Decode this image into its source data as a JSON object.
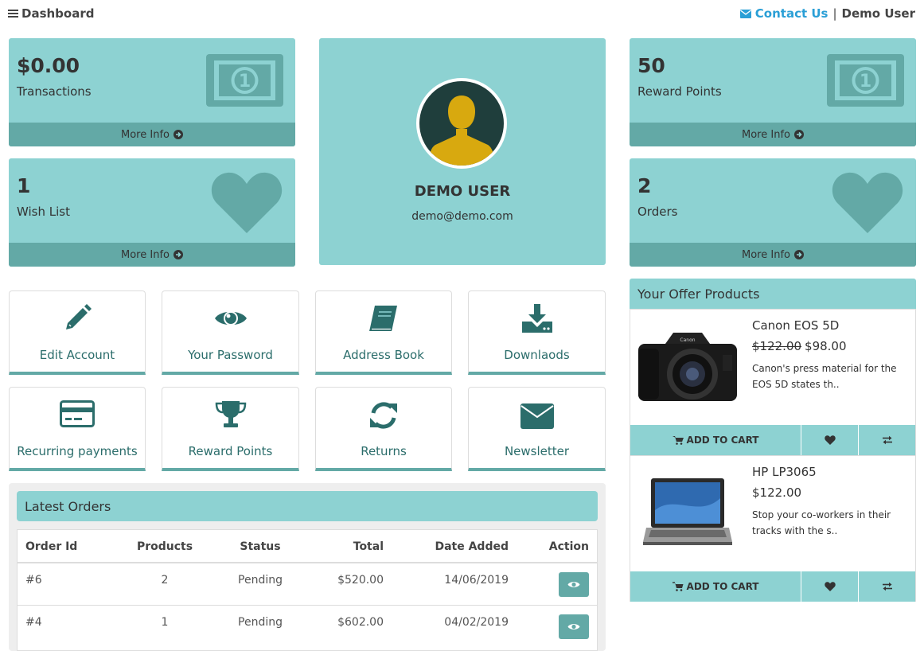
{
  "header": {
    "dashboard_label": "Dashboard",
    "menu_icon": "bars-icon",
    "contact_label": "Contact Us",
    "contact_icon": "envelope-icon",
    "separator": "|",
    "user_label": "Demo User"
  },
  "tiles": {
    "transactions": {
      "value": "$0.00",
      "label": "Transactions",
      "more": "More Info",
      "icon": "money-bill-icon"
    },
    "wishlist": {
      "value": "1",
      "label": "Wish List",
      "more": "More Info",
      "icon": "heart-icon"
    },
    "reward": {
      "value": "50",
      "label": "Reward Points",
      "more": "More Info",
      "icon": "money-bill-icon"
    },
    "orders": {
      "value": "2",
      "label": "Orders",
      "more": "More Info",
      "icon": "heart-icon"
    }
  },
  "profile": {
    "name": "DEMO USER",
    "email": "demo@demo.com"
  },
  "quick_links": [
    {
      "label": "Edit Account",
      "icon": "pencil-icon"
    },
    {
      "label": "Your Password",
      "icon": "eye-icon"
    },
    {
      "label": "Address Book",
      "icon": "book-icon"
    },
    {
      "label": "Downlaods",
      "icon": "download-icon"
    },
    {
      "label": "Recurring payments",
      "icon": "credit-card-icon"
    },
    {
      "label": "Reward Points",
      "icon": "trophy-icon"
    },
    {
      "label": "Returns",
      "icon": "refresh-icon"
    },
    {
      "label": "Newsletter",
      "icon": "envelope-icon"
    }
  ],
  "latest_orders": {
    "title": "Latest Orders",
    "columns": [
      "Order Id",
      "Products",
      "Status",
      "Total",
      "Date Added",
      "Action"
    ],
    "rows": [
      {
        "id": "#6",
        "products": "2",
        "status": "Pending",
        "total": "$520.00",
        "date": "14/06/2019"
      },
      {
        "id": "#4",
        "products": "1",
        "status": "Pending",
        "total": "$602.00",
        "date": "04/02/2019"
      }
    ]
  },
  "offers": {
    "title": "Your Offer Products",
    "products": [
      {
        "name": "Canon EOS 5D",
        "old_price": "$122.00",
        "price": "$98.00",
        "desc": "Canon's press material for the EOS 5D states th..",
        "cart": "ADD TO CART"
      },
      {
        "name": "HP LP3065",
        "old_price": "",
        "price": "$122.00",
        "desc": "Stop your co-workers in their tracks with the s..",
        "cart": "ADD TO CART"
      }
    ]
  },
  "colors": {
    "tile": "#8dd2d2",
    "tile_dark": "#63a9a6",
    "icon": "#2b6d6b",
    "link": "#2a9fd6"
  }
}
